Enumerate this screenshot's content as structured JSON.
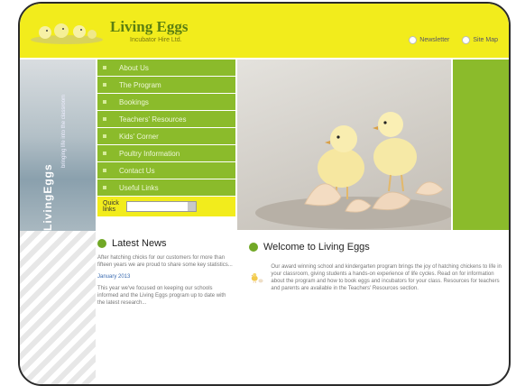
{
  "header": {
    "title": "Living Eggs",
    "subtitle": "Incubator Hire Ltd.",
    "links": [
      {
        "label": "Newsletter"
      },
      {
        "label": "Site Map"
      }
    ]
  },
  "side": {
    "vertical_title": "LivingEggs",
    "vertical_sub": "bringing life into the classroom"
  },
  "nav": {
    "items": [
      {
        "label": "About Us"
      },
      {
        "label": "The Program"
      },
      {
        "label": "Bookings"
      },
      {
        "label": "Teachers' Resources"
      },
      {
        "label": "Kids' Corner"
      },
      {
        "label": "Poultry Information"
      },
      {
        "label": "Contact Us"
      },
      {
        "label": "Useful Links"
      }
    ],
    "quick_links_label": "Quick links"
  },
  "news": {
    "heading": "Latest News",
    "body": "After hatching chicks for our customers for more than fifteen years we are proud to share some key statistics...",
    "date": "January 2013",
    "body2": "This year we've focused on keeping our schools informed and the Living Eggs program up to date with the latest research..."
  },
  "welcome": {
    "heading": "Welcome to Living Eggs",
    "body": "Our award winning school and kindergarten program brings the joy of hatching chickens to life in your classroom, giving students a hands-on experience of life cycles. Read on for information about the program and how to book eggs and incubators for your class. Resources for teachers and parents are available in the Teachers' Resources section."
  },
  "colors": {
    "header_yellow": "#f2ec1c",
    "nav_green": "#8bbb2b",
    "icon_green": "#71a826"
  }
}
